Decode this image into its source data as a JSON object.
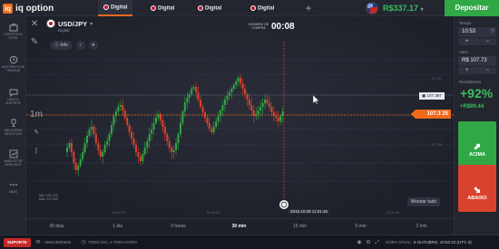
{
  "header": {
    "logo_text": "iq option",
    "tabs": [
      {
        "pair": "",
        "type": "Digital",
        "active": true
      },
      {
        "pair": "",
        "type": "Digital",
        "active": false
      },
      {
        "pair": "",
        "type": "Digital",
        "active": false
      },
      {
        "pair": "",
        "type": "Digital",
        "active": false
      }
    ],
    "add_tab": "+",
    "balance": "R$337.17",
    "balance_caret": "▾",
    "deposit_label": "Depositar"
  },
  "sidebar": {
    "items": [
      {
        "label": "Portfólio total",
        "icon": "briefcase-icon"
      },
      {
        "label": "Histórico de trading",
        "icon": "history-icon"
      },
      {
        "label": "Chat e suporte",
        "icon": "chat-icon"
      },
      {
        "label": "Melhores negócios",
        "icon": "trophy-icon"
      },
      {
        "label": "Análise de mercado",
        "icon": "analysis-icon"
      },
      {
        "label": "Mais",
        "icon": "more-icon"
      }
    ]
  },
  "chart": {
    "pair": "USD/JPY",
    "pair_caret": "▾",
    "type": "Digital",
    "info_label": "Info",
    "purchase_time_label": "HORÁRIO DE COMPRA",
    "timer": "00:08",
    "current_price": "107.3 25",
    "marked_price": "107.387",
    "scale_labels": [
      "107.41",
      "107.35"
    ],
    "time_labels": [
      "10:00:00",
      "10:30:00",
      "11:00:00"
    ],
    "min_max": [
      "Mín. 107.178",
      "Máx. 107.422"
    ],
    "expiry_tag": "2019.10.09 11:01:45",
    "show_all_label": "Mostrar tudo",
    "chart_mode_label": "1m",
    "colors": {
      "up": "#2fa845",
      "down": "#d9432e",
      "current": "#f06a1c",
      "expiry": "#e84040"
    }
  },
  "timeframes": [
    {
      "label": "30 dias"
    },
    {
      "label": "1 dia"
    },
    {
      "label": "3 horas"
    },
    {
      "label": "30 min"
    },
    {
      "label": "15 min"
    },
    {
      "label": "5 min"
    },
    {
      "label": "2 min"
    }
  ],
  "right_panel": {
    "time_label": "Tempo",
    "time_value": "10:53",
    "amount_label": "Valor",
    "amount_value": "R$ 107.73",
    "payout_label": "Rendimento",
    "payout_pct": "+92%",
    "payout_profit": "+R$99.44",
    "up_label": "ACIMA",
    "down_label": "ABAIXO",
    "plus": "+",
    "minus": "−"
  },
  "footer": {
    "support_label": "SUPORTE",
    "phone": "+55613500630",
    "availability": "TODO DIA, A TODA HORA",
    "current_time_label": "HORA ATUAL:",
    "current_time_value": "9 OUTUBRO, 10:52:22 (UTC-3)"
  }
}
